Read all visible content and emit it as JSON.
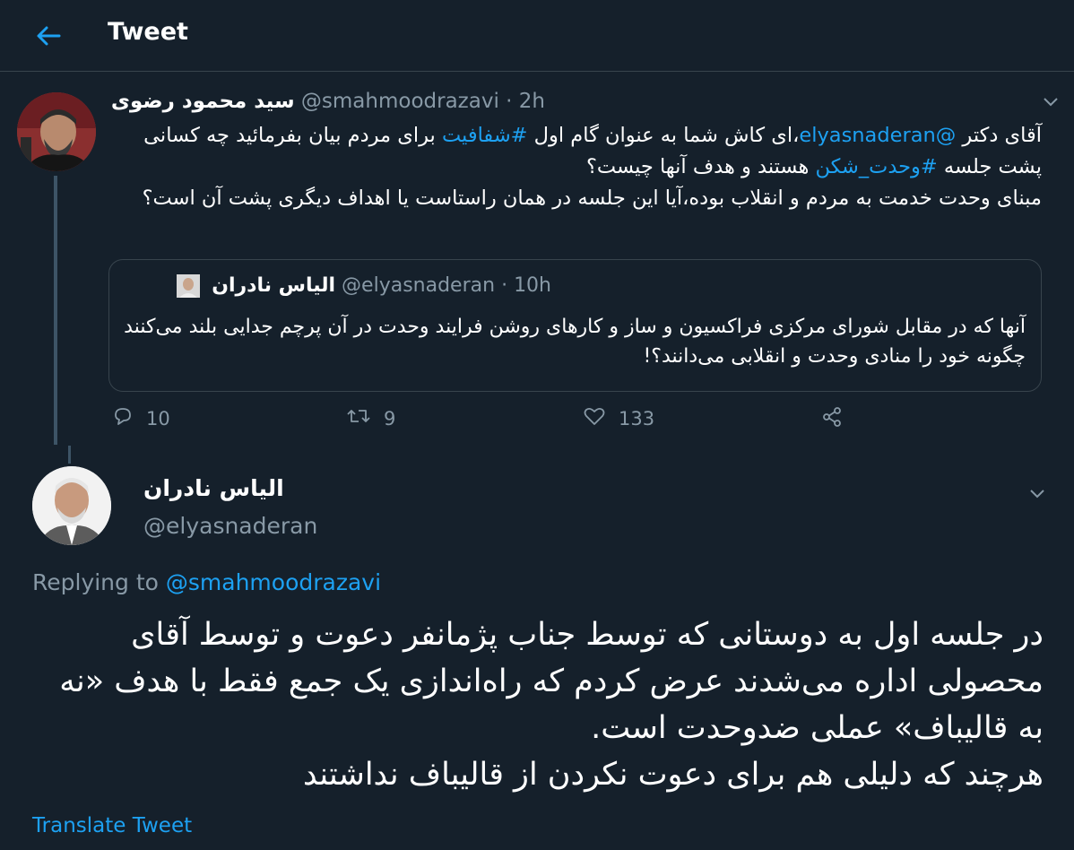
{
  "header": {
    "title": "Tweet"
  },
  "tweet1": {
    "author_name": "سید محمود رضوی",
    "handle": "@smahmoodrazavi",
    "separator": "·",
    "time": "2h",
    "body": {
      "seg1": "آقای دکتر ",
      "mention": "@elyasnaderan",
      "seg2": "،ای کاش شما به عنوان گام اول ",
      "hashtag1": "#شفافیت",
      "seg3": " برای مردم بیان بفرمائید چه کسانی پشت جلسه ",
      "hashtag2": "#وحدت_شکن",
      "seg4": " هستند و هدف آنها چیست؟",
      "para2": "مبنای وحدت خدمت به مردم و انقلاب بوده،آیا این جلسه در همان راستاست یا اهداف دیگری پشت آن است؟"
    },
    "quote": {
      "author_name": "الیاس نادران",
      "handle": "@elyasnaderan",
      "separator": "·",
      "time": "10h",
      "body": "آنها که در مقابل شورای مرکزی فراکسیون و ساز و کارهای روشن فرایند وحدت در آن پرچم جدایی بلند می‌کنند چگونه خود را منادی وحدت و انقلابی می‌دانند؟!"
    },
    "actions": {
      "replies": "10",
      "retweets": "9",
      "likes": "133"
    }
  },
  "tweet2": {
    "author_name": "الیاس نادران",
    "handle": "@elyasnaderan",
    "replying_prefix": "Replying to ",
    "replying_handle": "@smahmoodrazavi",
    "body_line1": "در جلسه اول به دوستانی که توسط جناب پژمانفر دعوت و توسط آقای محصولی اداره می‌شدند عرض کردم که راه‌اندازی یک جمع فقط با هدف «نه به قالیباف» عملی ضدوحدت است.",
    "body_line2": "هرچند که دلیلی هم برای دعوت نکردن از قالیباف نداشتند",
    "translate": "Translate Tweet"
  },
  "colors": {
    "background": "#15202b",
    "accent": "#1da1f2",
    "muted": "#8899a6",
    "border": "#38444d"
  }
}
